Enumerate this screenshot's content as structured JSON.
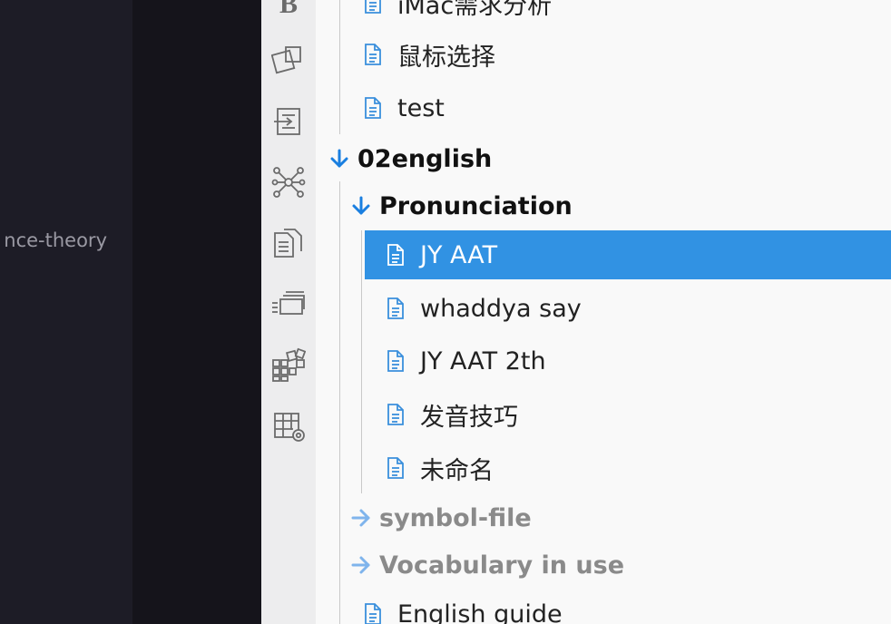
{
  "background_panel": {
    "text": "nce-theory"
  },
  "toolbar": {
    "tools": [
      {
        "icon": "bold-b-icon"
      },
      {
        "icon": "shapes-icon"
      },
      {
        "icon": "import-icon"
      },
      {
        "icon": "network-graph-icon"
      },
      {
        "icon": "copy-documents-icon"
      },
      {
        "icon": "stack-cards-icon"
      },
      {
        "icon": "grid-blocks-icon"
      },
      {
        "icon": "table-settings-icon"
      }
    ]
  },
  "tree": {
    "items": [
      {
        "type": "doc",
        "label": "iMac需求分析"
      },
      {
        "type": "doc",
        "label": "鼠标选择"
      },
      {
        "type": "doc",
        "label": "test"
      },
      {
        "type": "folder",
        "label": "02english",
        "expanded": true
      },
      {
        "type": "folder",
        "label": "Pronunciation",
        "expanded": true
      },
      {
        "type": "doc",
        "label": "JY AAT",
        "selected": true
      },
      {
        "type": "doc",
        "label": "whaddya say"
      },
      {
        "type": "doc",
        "label": "JY AAT 2th"
      },
      {
        "type": "doc",
        "label": "发音技巧"
      },
      {
        "type": "doc",
        "label": "未命名"
      },
      {
        "type": "folder",
        "label": "symbol-file",
        "expanded": false
      },
      {
        "type": "folder",
        "label": "Vocabulary in use",
        "expanded": false
      },
      {
        "type": "doc",
        "label": "English guide"
      }
    ]
  },
  "colors": {
    "selection": "#3192e3",
    "doc_icon": "#3a8fdc",
    "expanded_arrow": "#1a7fe0",
    "collapsed_arrow": "#7fb4ec"
  }
}
